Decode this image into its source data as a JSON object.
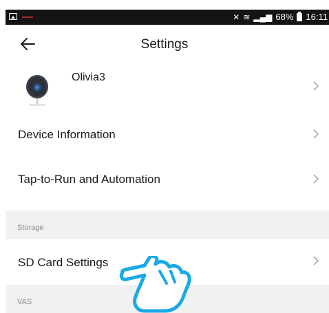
{
  "status_bar": {
    "battery": "68%",
    "time": "16:11"
  },
  "header": {
    "title": "Settings"
  },
  "device": {
    "name": "Olivia3"
  },
  "items": {
    "device_information": "Device Information",
    "tap_to_run": "Tap-to-Run and Automation",
    "sd_card": "SD Card Settings"
  },
  "sections": {
    "storage": "Storage",
    "vas": "VAS"
  },
  "colors": {
    "status_bar_bg": "#141414",
    "section_bg": "#f1f1f1",
    "hand_outline": "#1aa9e6",
    "camera_lens": "#2a4a7a"
  },
  "icons": {
    "back": "arrow-left-icon",
    "chevron": "chevron-right-icon",
    "camera": "camera-icon",
    "hand": "pointing-hand-icon"
  }
}
